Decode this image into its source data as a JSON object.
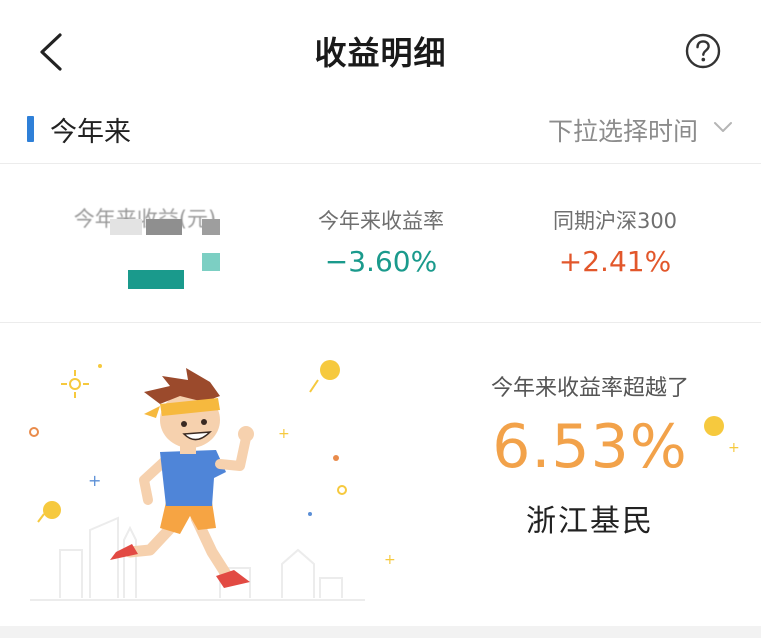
{
  "header": {
    "title": "收益明细",
    "back_icon": "chevron-left-icon",
    "help_icon": "question-circle-icon"
  },
  "period": {
    "label": "今年来",
    "selector_text": "下拉选择时间",
    "selector_icon": "chevron-down-icon"
  },
  "stats": [
    {
      "label": "今年来收益(元)",
      "value": ""
    },
    {
      "label": "今年来收益率",
      "value": "−3.60%"
    },
    {
      "label": "同期沪深300",
      "value": "+2.41%"
    }
  ],
  "achievement": {
    "text": "今年来收益率超越了",
    "percent": "6.53%",
    "subject": "浙江基民",
    "illustration": "running-man-illustration"
  },
  "colors": {
    "accent": "#2f80d8",
    "negative": "#1a9a8c",
    "positive": "#e2572b",
    "highlight": "#f2a24a"
  }
}
